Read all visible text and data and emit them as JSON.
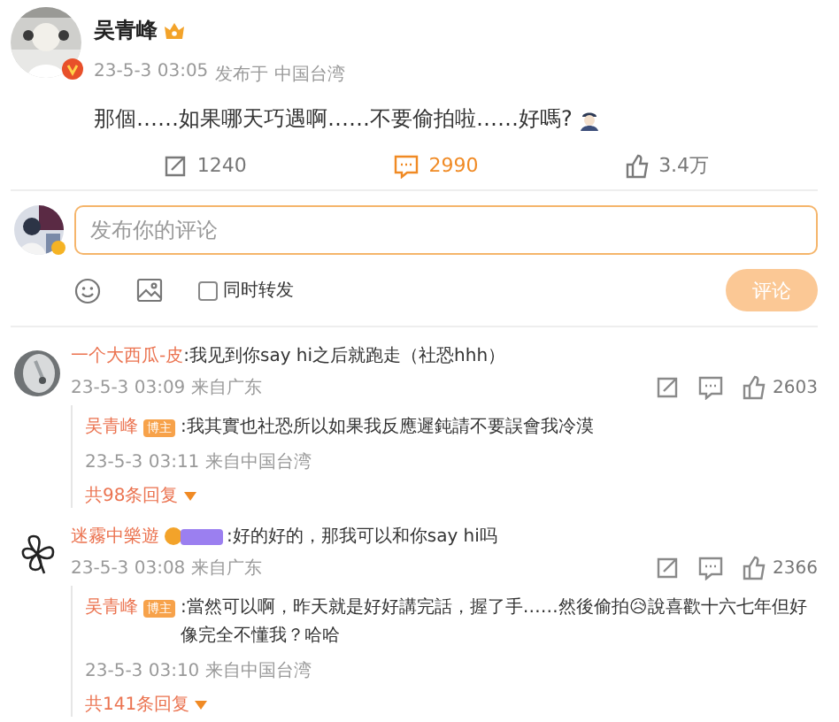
{
  "post": {
    "author": "吴青峰",
    "time": "23-5-3 03:05",
    "location": "发布于 中国台湾",
    "text": "那個……如果哪天巧遇啊……不要偷拍啦……好嗎?",
    "actions": [
      {
        "kind": "repost",
        "count": "1240",
        "selected": false
      },
      {
        "kind": "comment",
        "count": "2990",
        "selected": true
      },
      {
        "kind": "like",
        "count": "3.4万",
        "selected": false
      }
    ]
  },
  "composer": {
    "placeholder": "发布你的评论",
    "repost_label": "同时转发",
    "repost_checked": false,
    "submit": "评论",
    "submit_disabled": true
  },
  "comments": [
    {
      "name": "一个大西瓜-皮",
      "fan_badge": false,
      "text": ":我见到你say hi之后就跑走（社恐hhh）",
      "time": "23-5-3 03:09 来自广东",
      "likes": "2603",
      "reply": {
        "name": "吴青峰",
        "badge": "博主",
        "text": ":我其實也社恐所以如果我反應遲鈍請不要誤會我冷漠",
        "time": "23-5-3 03:11 来自中国台湾"
      },
      "more": "共98条回复"
    },
    {
      "name": "迷霧中樂遊",
      "fan_badge": true,
      "text": ":好的好的，那我可以和你say hi吗",
      "time": "23-5-3 03:08 来自广东",
      "likes": "2366",
      "reply": {
        "name": "吴青峰",
        "badge": "博主",
        "text": ":當然可以啊，昨天就是好好講完話，握了手……然後偷拍😥說喜歡十六七年但好像完全不懂我？哈哈",
        "time": "23-5-3 03:10 来自中国台湾"
      },
      "more": "共141条回复"
    }
  ]
}
